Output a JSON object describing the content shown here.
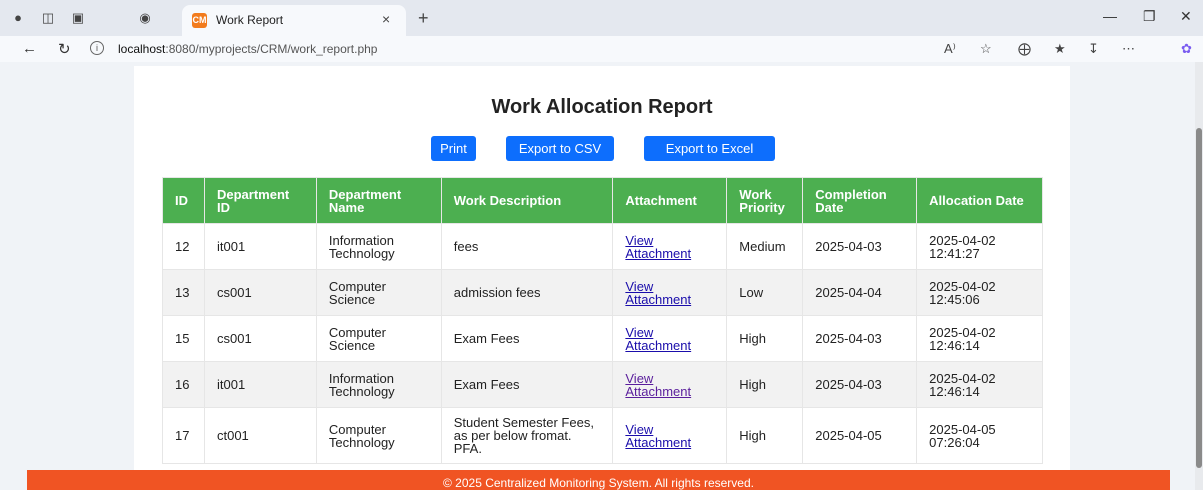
{
  "browser": {
    "tab_title": "Work Report",
    "tab_favicon": "CM",
    "close_glyph": "×",
    "new_tab_glyph": "+",
    "url_host": "localhost",
    "url_path": ":8080/myprojects/CRM/work_report.php"
  },
  "page": {
    "title": "Work Allocation Report",
    "buttons": {
      "print": "Print",
      "export_csv": "Export to CSV",
      "export_excel": "Export to Excel"
    },
    "table": {
      "headers": [
        "ID",
        "Department ID",
        "Department Name",
        "Work Description",
        "Attachment",
        "Work Priority",
        "Completion Date",
        "Allocation Date"
      ],
      "rows": [
        {
          "id": "12",
          "dept_id": "it001",
          "dept_name": "Information Technology",
          "desc": "fees",
          "attachment": "View Attachment",
          "priority": "Medium",
          "completion": "2025-04-03",
          "allocation": "2025-04-02 12:41:27"
        },
        {
          "id": "13",
          "dept_id": "cs001",
          "dept_name": "Computer Science",
          "desc": "admission fees",
          "attachment": "View Attachment",
          "priority": "Low",
          "completion": "2025-04-04",
          "allocation": "2025-04-02 12:45:06"
        },
        {
          "id": "15",
          "dept_id": "cs001",
          "dept_name": "Computer Science",
          "desc": "Exam Fees",
          "attachment": "View Attachment",
          "priority": "High",
          "completion": "2025-04-03",
          "allocation": "2025-04-02 12:46:14"
        },
        {
          "id": "16",
          "dept_id": "it001",
          "dept_name": "Information Technology",
          "desc": "Exam Fees",
          "attachment": "View Attachment",
          "priority": "High",
          "completion": "2025-04-03",
          "allocation": "2025-04-02 12:46:14"
        },
        {
          "id": "17",
          "dept_id": "ct001",
          "dept_name": "Computer Technology",
          "desc": "Student Semester Fees, as per below fromat. PFA.",
          "attachment": "View Attachment",
          "priority": "High",
          "completion": "2025-04-05",
          "allocation": "2025-04-05 07:26:04"
        }
      ]
    },
    "footer": "© 2025 Centralized Monitoring System. All rights reserved."
  },
  "colors": {
    "header_green": "#4caf50",
    "button_blue": "#0d6efd",
    "footer_orange": "#f05423"
  }
}
